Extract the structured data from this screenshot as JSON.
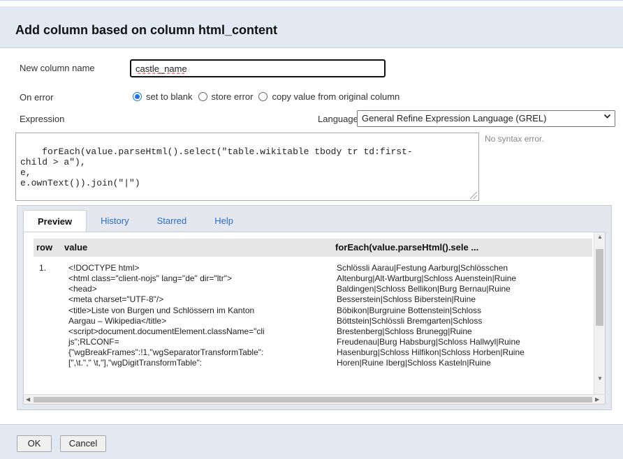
{
  "dialog": {
    "title": "Add column based on column html_content"
  },
  "form": {
    "new_column_label": "New column name",
    "new_column_value": "castle_name",
    "on_error_label": "On error",
    "on_error_options": [
      {
        "label": "set to blank",
        "checked": true
      },
      {
        "label": "store error",
        "checked": false
      },
      {
        "label": "copy value from original column",
        "checked": false
      }
    ],
    "expression_label": "Expression",
    "language_label": "Language",
    "language_selected": "General Refine Expression Language (GREL)",
    "expression": "forEach(value.parseHtml().select(\"table.wikitable tbody tr td:first-\nchild > a\"),\ne,\ne.ownText()).join(\"|\")",
    "syntax_status": "No syntax error."
  },
  "tabs": [
    "Preview",
    "History",
    "Starred",
    "Help"
  ],
  "active_tab": "Preview",
  "preview": {
    "headers": [
      "row",
      "value",
      "forEach(value.parseHtml().sele ..."
    ],
    "row_number": "1.",
    "value_lines": [
      "<!DOCTYPE html>",
      "<html class=\"client-nojs\" lang=\"de\" dir=\"ltr\">",
      "<head>",
      "<meta charset=\"UTF-8\"/>",
      "<title>Liste von Burgen und Schlössern im Kanton",
      "Aargau – Wikipedia</title>",
      "<script>document.documentElement.className=\"cli",
      "js\";RLCONF=",
      "{\"wgBreakFrames\":!1,\"wgSeparatorTransformTable\":",
      "[\",\\t.\",\" \\t,\"],\"wgDigitTransformTable\":"
    ],
    "result_lines": [
      "Schlössli Aarau|Festung Aarburg|Schlösschen",
      "Altenburg|Alt-Wartburg|Schloss Auenstein|Ruine",
      "Baldingen|Schloss Bellikon|Burg Bernau|Ruine",
      "Besserstein|Schloss Biberstein|Ruine",
      "Böbikon|Burgruine Bottenstein|Schloss",
      "Böttstein|Schlössli Bremgarten|Schloss",
      "Brestenberg|Schloss Brunegg|Ruine",
      "Freudenau|Burg Habsburg|Schloss Hallwyl|Ruine",
      "Hasenburg|Schloss Hilfikon|Schloss Horben|Ruine",
      "Horen|Ruine Iberg|Schloss Kasteln|Ruine"
    ]
  },
  "footer": {
    "ok_label": "OK",
    "cancel_label": "Cancel"
  },
  "colors": {
    "header_bg": "#e3e9f3",
    "tab_link": "#2b6ac7",
    "radio_accent": "#1a73e8"
  }
}
